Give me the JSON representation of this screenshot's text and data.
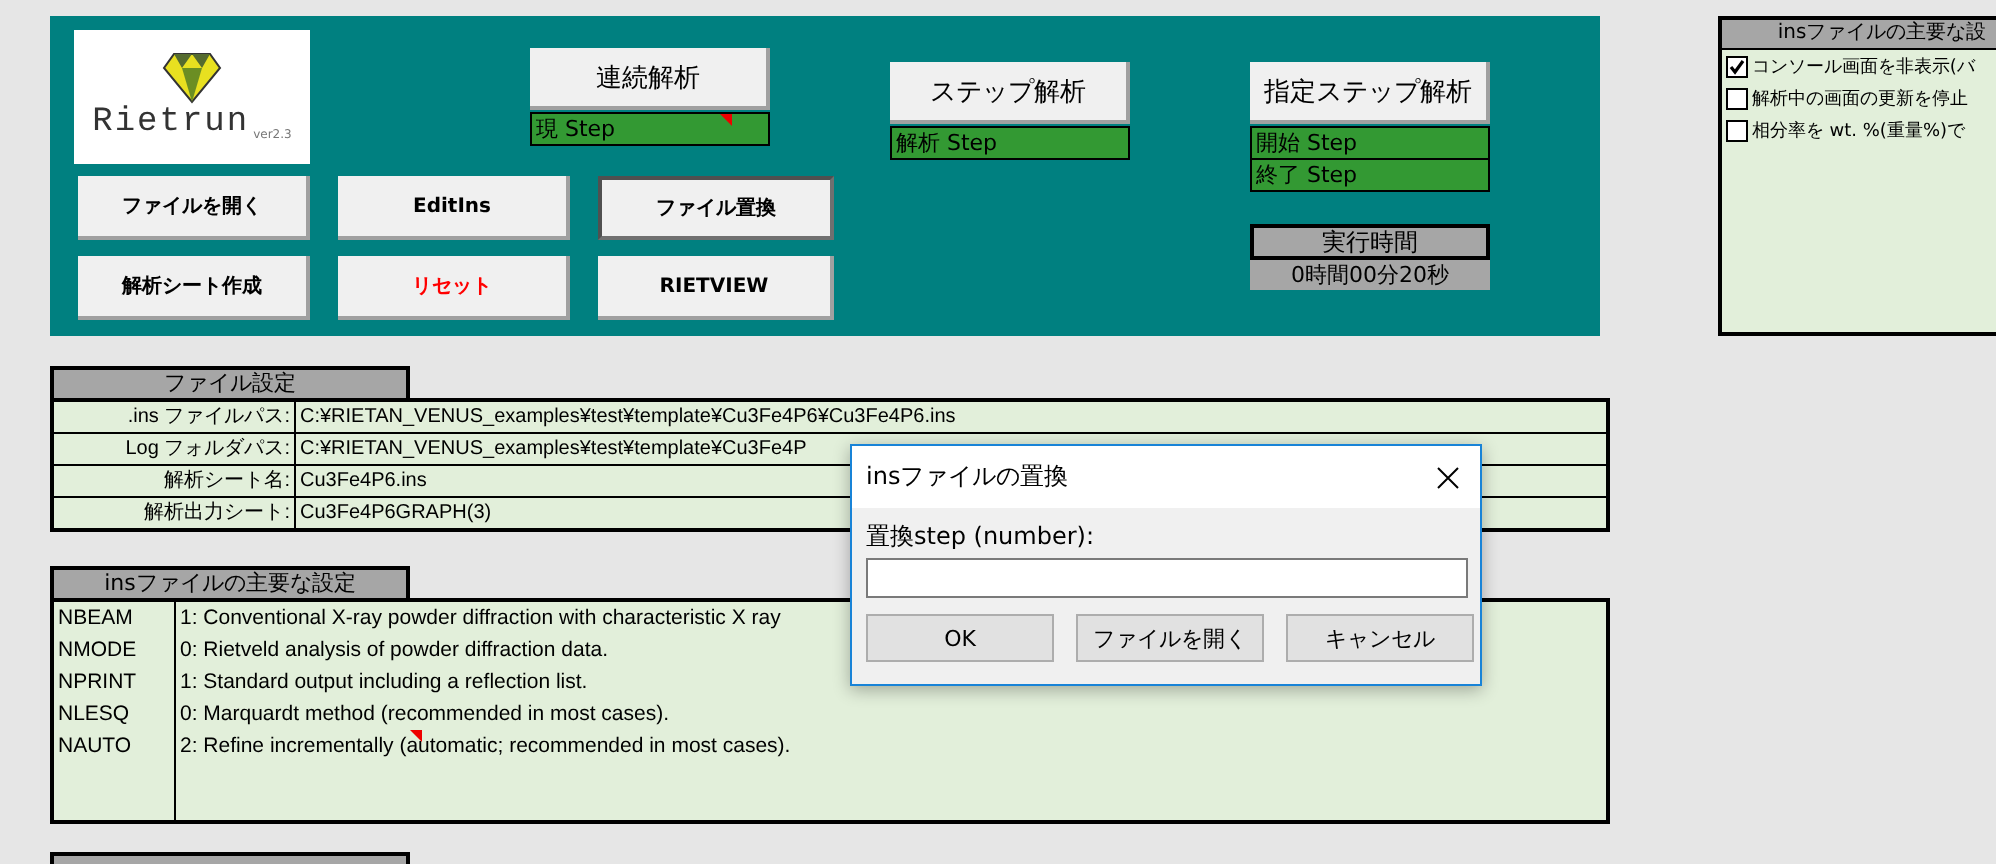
{
  "logo": {
    "name": "Rietrun",
    "version": "ver2.3"
  },
  "left_buttons": [
    {
      "label": "ファイルを開く",
      "kind": "normal",
      "pressed": false
    },
    {
      "label": "EditIns",
      "kind": "normal",
      "pressed": false
    },
    {
      "label": "ファイル置換",
      "kind": "normal",
      "pressed": true
    },
    {
      "label": "解析シート作成",
      "kind": "normal",
      "pressed": false
    },
    {
      "label": "リセット",
      "kind": "danger",
      "pressed": false
    },
    {
      "label": "RIETVIEW",
      "kind": "normal",
      "pressed": false
    }
  ],
  "run_groups": [
    {
      "button": "連続解析",
      "fields": [
        {
          "label": "現 Step",
          "comment": true
        }
      ]
    },
    {
      "button": "ステップ解析",
      "fields": [
        {
          "label": "解析 Step",
          "comment": false
        }
      ]
    },
    {
      "button": "指定ステップ解析",
      "fields": [
        {
          "label": "開始 Step",
          "comment": false
        },
        {
          "label": "終了 Step",
          "comment": false
        }
      ]
    }
  ],
  "elapsed": {
    "label": "実行時間",
    "value": "0時間00分20秒"
  },
  "options_panel": {
    "title": "insファイルの主要な設",
    "options": [
      {
        "label": "コンソール画面を非表示(バ",
        "checked": true
      },
      {
        "label": "解析中の画面の更新を停止",
        "checked": false
      },
      {
        "label": "相分率を wt. %(重量%)で",
        "checked": false
      }
    ]
  },
  "file_settings": {
    "title": "ファイル設定",
    "rows": [
      {
        "label": ".ins ファイルパス:",
        "value": "C:¥RIETAN_VENUS_examples¥test¥template¥Cu3Fe4P6¥Cu3Fe4P6.ins"
      },
      {
        "label": "Log フォルダパス:",
        "value": "C:¥RIETAN_VENUS_examples¥test¥template¥Cu3Fe4P"
      },
      {
        "label": "解析シート名:",
        "value": "Cu3Fe4P6.ins"
      },
      {
        "label": "解析出力シート:",
        "value": "Cu3Fe4P6GRAPH(3)"
      }
    ]
  },
  "ins_settings": {
    "title": "insファイルの主要な設定",
    "rows": [
      {
        "key": "NBEAM",
        "value": "1: Conventional X-ray powder diffraction with characteristic X ray",
        "comment": false
      },
      {
        "key": "NMODE",
        "value": "0: Rietveld analysis of powder diffraction data.",
        "comment": false
      },
      {
        "key": "NPRINT",
        "value": "1: Standard output including a reflection list.",
        "comment": false
      },
      {
        "key": "NLESQ",
        "value": "0: Marquardt method (recommended in most cases).",
        "comment": false
      },
      {
        "key": "NAUTO",
        "value": "2: Refine incrementally (automatic; recommended in most cases).",
        "comment": true
      }
    ]
  },
  "dialog": {
    "title": "insファイルの置換",
    "prompt": "置換step (number):",
    "buttons": [
      "OK",
      "ファイルを開く",
      "キャンセル"
    ]
  }
}
